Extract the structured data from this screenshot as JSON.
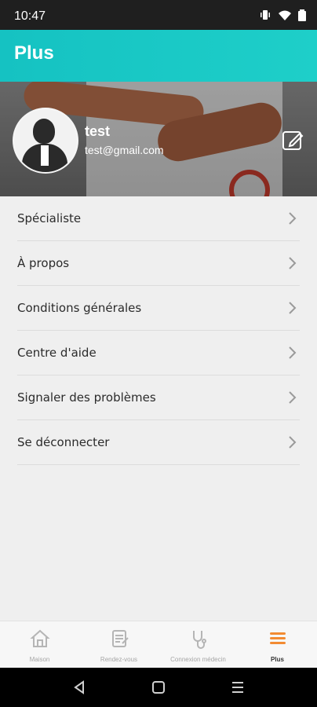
{
  "status": {
    "time": "10:47"
  },
  "header": {
    "title": "Plus"
  },
  "profile": {
    "name": "test",
    "email": "test@gmail.com"
  },
  "menu": {
    "items": [
      {
        "label": "Spécialiste"
      },
      {
        "label": "À propos"
      },
      {
        "label": "Conditions générales"
      },
      {
        "label": "Centre d'aide"
      },
      {
        "label": "Signaler des problèmes"
      },
      {
        "label": "Se déconnecter"
      }
    ]
  },
  "nav": {
    "items": [
      {
        "label": "Maison",
        "icon": "home-icon"
      },
      {
        "label": "Rendez-vous",
        "icon": "appointment-icon"
      },
      {
        "label": "Connexion médecin",
        "icon": "stethoscope-icon"
      },
      {
        "label": "Plus",
        "icon": "menu-icon"
      }
    ],
    "active": "Plus"
  },
  "colors": {
    "accent": "#1ECFC9",
    "active_icon": "#F28B32"
  }
}
